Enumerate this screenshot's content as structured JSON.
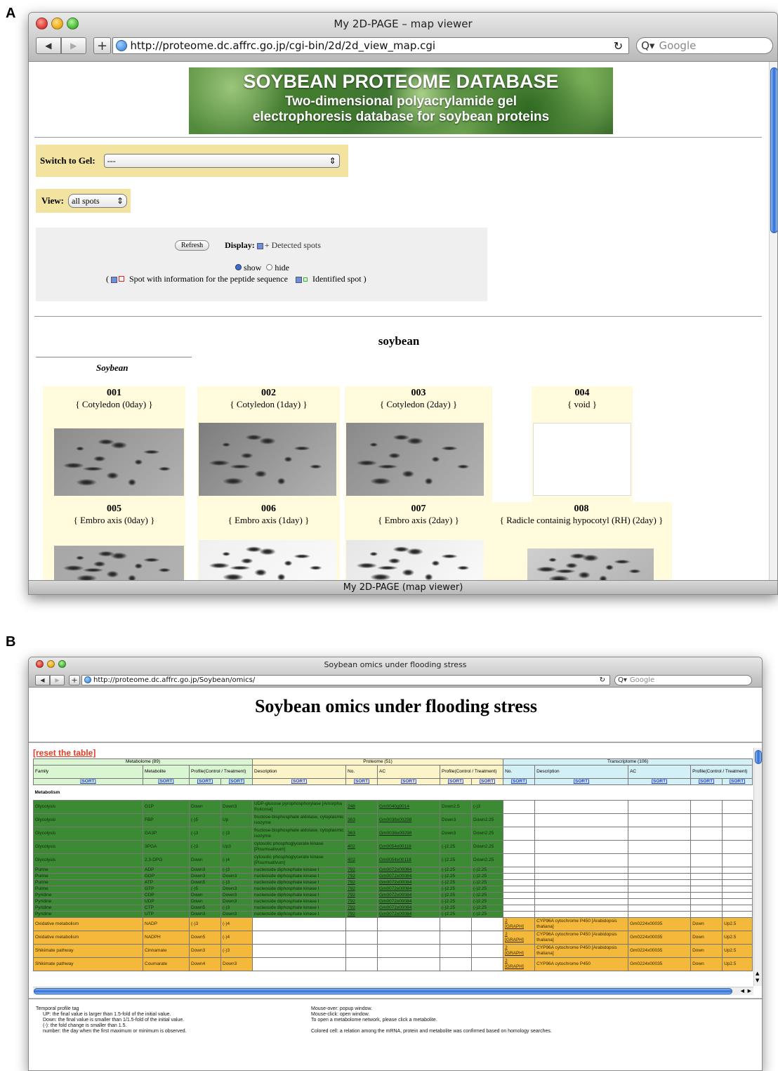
{
  "panel_a": {
    "label": "A",
    "window_title": "My 2D-PAGE – map viewer",
    "url": "http://proteome.dc.affrc.go.jp/cgi-bin/2d/2d_view_map.cgi",
    "search_placeholder": "Google",
    "banner": {
      "title": "SOYBEAN PROTEOME DATABASE",
      "line1": "Two-dimensional polyacrylamide gel",
      "line2": "electrophoresis database for soybean proteins"
    },
    "switch_label": "Switch to Gel:",
    "switch_value": "---",
    "view_label": "View:",
    "view_value": "all spots",
    "refresh_label": "Refresh",
    "display_label": "Display:",
    "detected_label": "+ Detected spots",
    "show_label": "show",
    "hide_label": "hide",
    "peptide_label": "Spot with information for the peptide sequence",
    "identified_label": "Identified spot",
    "paren_open": "(",
    "paren_close": ")",
    "section_title": "soybean",
    "tab_label": "Soybean",
    "gels": [
      {
        "num": "001",
        "desc": "{ Cotyledon (0day) }"
      },
      {
        "num": "002",
        "desc": "{ Cotyledon (1day) }"
      },
      {
        "num": "003",
        "desc": "{ Cotyledon (2day) }"
      },
      {
        "num": "004",
        "desc": "{ void }"
      },
      {
        "num": "005",
        "desc": "{ Embro axis (0day) }"
      },
      {
        "num": "006",
        "desc": "{ Embro axis (1day) }"
      },
      {
        "num": "007",
        "desc": "{ Embro axis (2day) }"
      },
      {
        "num": "008",
        "desc": "{ Radicle containig hypocotyl (RH) (2day) }"
      }
    ],
    "status_text": "My 2D-PAGE (map viewer)"
  },
  "panel_b": {
    "label": "B",
    "window_title": "Soybean omics under flooding stress",
    "url": "http://proteome.dc.affrc.go.jp/Soybean/omics/",
    "search_placeholder": "Google",
    "page_title": "Soybean omics under flooding stress",
    "reset_label": "[reset the table]",
    "groups": {
      "metabolome": "Metabolome (89)",
      "proteome": "Proteome (51)",
      "transcriptome": "Transcriptome (106)"
    },
    "headers": [
      "Family",
      "Metabolite",
      "Profile(Control / Treatment)",
      "Description",
      "No.",
      "AC",
      "Profile(Control / Treatment)",
      "No.",
      "Description",
      "AC",
      "Profile(Control / Treatment)"
    ],
    "sort_label": "[SORT]",
    "section": "Metabolism",
    "graph_label": "[GRAPH]",
    "rows": [
      {
        "fam": "Glycolysis",
        "met": "G1P",
        "p1": "Down",
        "p2": "Down3",
        "desc": "UDP-glucose pyrophosphorylase [Amorpha fruticosa]",
        "no": "248",
        "ac": "Gm0040g0014",
        "q1": "Down2.5",
        "q2": "(-)3",
        "tall": true
      },
      {
        "fam": "Glycolysis",
        "met": "FBP",
        "p1": "(-)5",
        "p2": "Up",
        "desc": "fructose-bisphosphate aldolase, cytoplasmic isozyme",
        "no": "363",
        "ac": "Gm0036x00298",
        "q1": "Down3",
        "q2": "Down2.25",
        "tall": true
      },
      {
        "fam": "Glycolysis",
        "met": "GA3P",
        "p1": "(-)3",
        "p2": "(-)3",
        "desc": "fructose-bisphosphate aldolase, cytoplasmic isozyme",
        "no": "363",
        "ac": "Gm0036x00298",
        "q1": "Down3",
        "q2": "Down2.25",
        "tall": true
      },
      {
        "fam": "Glycolysis",
        "met": "3PGA",
        "p1": "(-)3",
        "p2": "Up3",
        "desc": "cytosolic phosphoglycerate kinase [Pisumsativum]",
        "no": "402",
        "ac": "Gm0054x00118",
        "q1": "(-)2.25",
        "q2": "Down2.25",
        "tall": true
      },
      {
        "fam": "Glycolysis",
        "met": "2,3-DPG",
        "p1": "Down",
        "p2": "(-)4",
        "desc": "cytosolic phosphoglycerate kinase [Pisumsativum]",
        "no": "402",
        "ac": "Gm0054x00118",
        "q1": "(-)2.25",
        "q2": "Down2.25",
        "tall": true
      },
      {
        "fam": "Purine",
        "met": "ADP",
        "p1": "Down3",
        "p2": "(-)3",
        "desc": "nucleoside diphosphate kinase I",
        "no": "792",
        "ac": "Gm0072x00084",
        "q1": "(-)2.25",
        "q2": "(-)2.25"
      },
      {
        "fam": "Purine",
        "met": "GDP",
        "p1": "Down3",
        "p2": "Down3",
        "desc": "nucleoside diphosphate kinase I",
        "no": "792",
        "ac": "Gm0072x00084",
        "q1": "(-)2.25",
        "q2": "(-)2.25"
      },
      {
        "fam": "Purine",
        "met": "ATP",
        "p1": "Down5",
        "p2": "(-)3",
        "desc": "nucleoside diphosphate kinase I",
        "no": "792",
        "ac": "Gm0072x00084",
        "q1": "(-)2.25",
        "q2": "(-)2.25"
      },
      {
        "fam": "Purine",
        "met": "GTP",
        "p1": "(-)5",
        "p2": "Down3",
        "desc": "nucleoside diphosphate kinase I",
        "no": "792",
        "ac": "Gm0072x00084",
        "q1": "(-)2.25",
        "q2": "(-)2.25"
      },
      {
        "fam": "Pyridine",
        "met": "CDP",
        "p1": "Down",
        "p2": "Down3",
        "desc": "nucleoside diphosphate kinase I",
        "no": "792",
        "ac": "Gm0072x00084",
        "q1": "(-)2.25",
        "q2": "(-)2.25"
      },
      {
        "fam": "Pyridine",
        "met": "UDP",
        "p1": "Down",
        "p2": "Down3",
        "desc": "nucleoside diphosphate kinase I",
        "no": "792",
        "ac": "Gm0072x00084",
        "q1": "(-)2.25",
        "q2": "(-)2.25"
      },
      {
        "fam": "Pyridine",
        "met": "CTP",
        "p1": "Down5",
        "p2": "(-)3",
        "desc": "nucleoside diphosphate kinase I",
        "no": "792",
        "ac": "Gm0072x00084",
        "q1": "(-)2.25",
        "q2": "(-)2.25"
      },
      {
        "fam": "Pyridine",
        "met": "UTP",
        "p1": "Down3",
        "p2": "Down3",
        "desc": "nucleoside diphosphate kinase I",
        "no": "792",
        "ac": "Gm0072x00084",
        "q1": "(-)2.25",
        "q2": "(-)2.25"
      }
    ],
    "orange_rows": [
      {
        "fam": "Oxidative metabolism",
        "met": "NADP",
        "p1": "(-)3",
        "p2": "(-)4",
        "tno": "2",
        "tdesc": "CYP96A cytochrome P450 [Arabidopsis thaliana]",
        "tac": "Gm0224x00035",
        "t1": "Down",
        "t2": "Up2.5"
      },
      {
        "fam": "Oxidative metabolism",
        "met": "NADPH",
        "p1": "Down5",
        "p2": "(-)4",
        "tno": "2",
        "tdesc": "CYP96A cytochrome P450 [Arabidopsis thaliana]",
        "tac": "Gm0224x00035",
        "t1": "Down",
        "t2": "Up2.5"
      },
      {
        "fam": "Shikimate pathway",
        "met": "Cinnamate",
        "p1": "Down3",
        "p2": "(-)3",
        "tno": "2",
        "tdesc": "CYP96A cytochrome P450 [Arabidopsis thaliana]",
        "tac": "Gm0224x00035",
        "t1": "Down",
        "t2": "Up2.5"
      },
      {
        "fam": "Shikimate pathway",
        "met": "Coumarate",
        "p1": "Down4",
        "p2": "Down3",
        "tno": "2",
        "tdesc": "CYP96A cytochrome P450",
        "tac": "Gm0224x00035",
        "t1": "Down",
        "t2": "Up2.5"
      }
    ],
    "legend_left": [
      "Temporal profile tag",
      "UP: the final value is larger than 1.5-fold of the initial value.",
      "Down: the final value is smaller than 1/1.5-fold of the initial value.",
      "(-): the fold change is smaller than 1.5.",
      "number: the day when the first maximum or minimum is observed."
    ],
    "legend_right": [
      "Mouse-over: popup window.",
      "Mouse-click: open window.",
      "To open a metabolome network, please click a metabolite.",
      "Colored cell: a relation among the mRNA, protein and metabolite was confirmed based on homology searches."
    ]
  }
}
